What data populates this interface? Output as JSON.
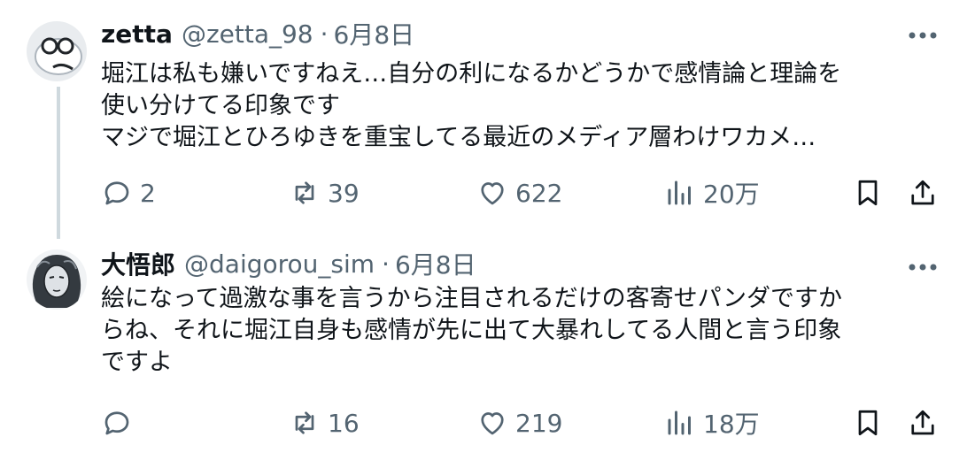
{
  "posts": [
    {
      "display_name": "zetta",
      "handle": "@zetta_98",
      "separator": "·",
      "date": "6月8日",
      "text": "堀江は私も嫌いですねえ…自分の利になるかどうかで感情論と理論を\n使い分けてる印象です\nマジで堀江とひろゆきを重宝してる最近のメディア層わけワカメ…",
      "replies": "2",
      "reposts": "39",
      "likes": "622",
      "views": "20万"
    },
    {
      "display_name": "大悟郎",
      "handle": "@daigorou_sim",
      "separator": "·",
      "date": "6月8日",
      "text": "絵になって過激な事を言うから注目されるだけの客寄せパンダですか\nらね、それに堀江自身も感情が先に出て大暴れしてる人間と言う印象\nですよ",
      "replies": "",
      "reposts": "16",
      "likes": "219",
      "views": "18万"
    }
  ],
  "icons": [
    "more-icon",
    "reply-icon",
    "repost-icon",
    "like-icon",
    "views-icon",
    "bookmark-icon",
    "share-icon"
  ],
  "colors": {
    "text": "#0f1419",
    "secondary": "#536471",
    "thread_line": "#cfd9de"
  }
}
